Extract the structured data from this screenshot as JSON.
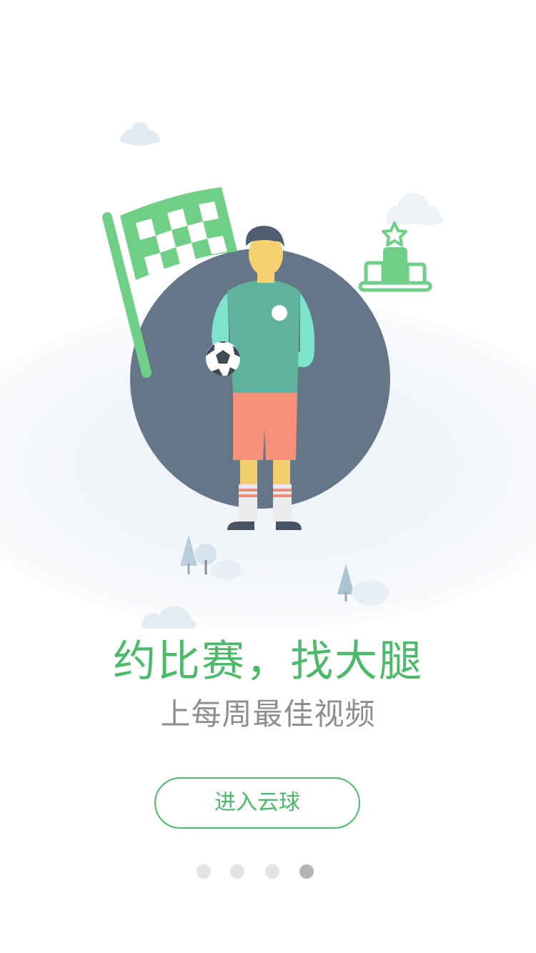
{
  "onboarding": {
    "headline": "约比赛，找大腿",
    "subline": "上每周最佳视频",
    "enter_button_label": "进入云球",
    "page_indicator": {
      "total": 4,
      "current": 4
    }
  },
  "colors": {
    "accent_green": "#4cba6a",
    "subtitle_gray": "#8e8e8e",
    "dot_inactive": "#e4e4e4",
    "dot_active": "#b3b3b3"
  },
  "illustration": {
    "icons": [
      "cloud-icon",
      "checkered-flag-icon",
      "soccer-player-icon",
      "soccer-ball-icon",
      "trophy-podium-icon",
      "tree-icon"
    ]
  }
}
